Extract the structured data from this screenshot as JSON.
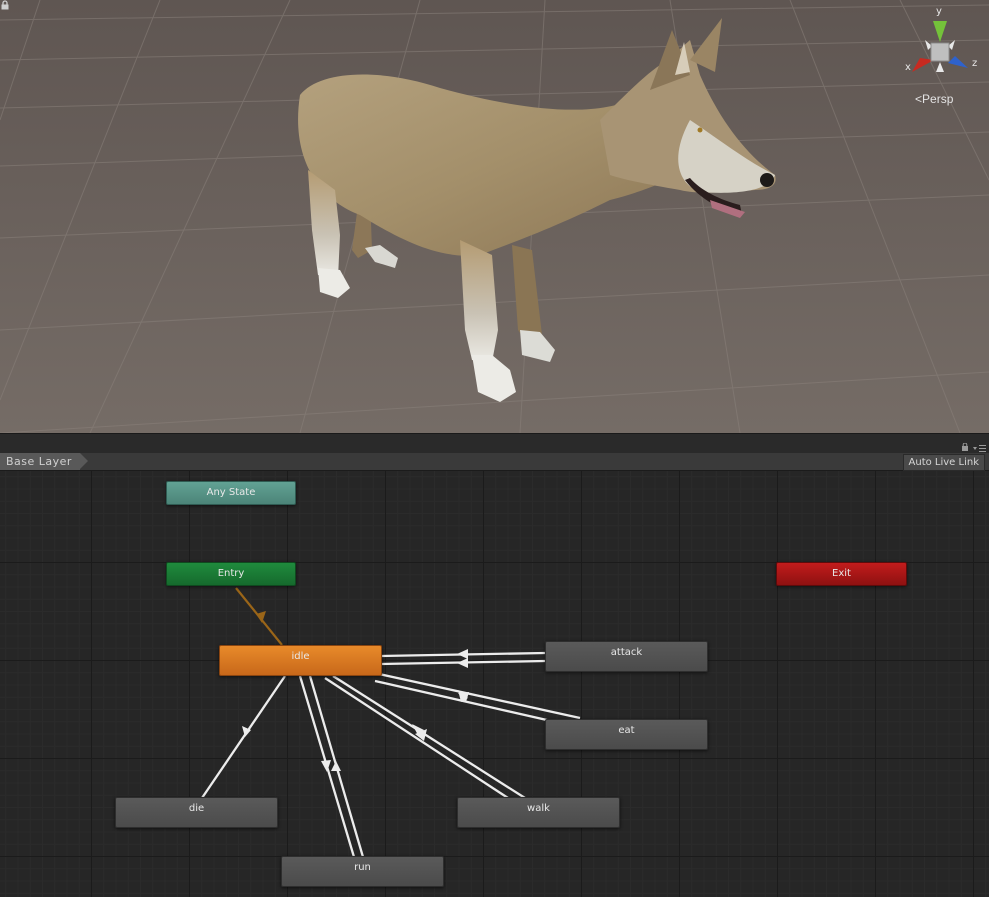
{
  "scene": {
    "view_mode": "Persp",
    "axis_labels": {
      "x": "x",
      "y": "y",
      "z": "z"
    },
    "ground_color": "#6e655f",
    "subject_icon": "wolf-model"
  },
  "animator": {
    "layer_name": "Base Layer",
    "auto_live_link_label": "Auto Live Link",
    "states": {
      "any_state": "Any State",
      "entry": "Entry",
      "exit": "Exit",
      "idle": "idle",
      "attack": "attack",
      "eat": "eat",
      "die": "die",
      "walk": "walk",
      "run": "run"
    },
    "colors": {
      "default_state": "#e88a2a",
      "entry": "#1f8b3d",
      "exit": "#c21c1c",
      "any_state": "#62a294",
      "state": "#555555"
    }
  }
}
